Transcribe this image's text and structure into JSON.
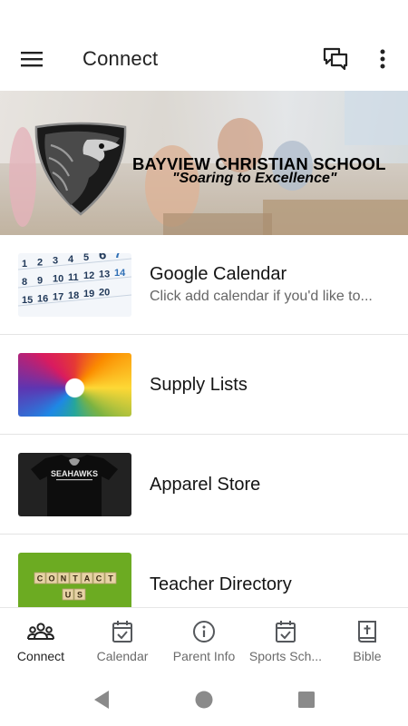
{
  "app_bar": {
    "title": "Connect",
    "menu_icon": "hamburger-menu-icon",
    "chat_icon": "chat-bubbles-icon",
    "more_icon": "more-vertical-icon"
  },
  "hero": {
    "school_name": "BAYVIEW CHRISTIAN SCHOOL",
    "motto": "\"Soaring to Excellence\"",
    "logo_icon": "hawk-shield-logo"
  },
  "list": {
    "items": [
      {
        "title": "Google Calendar",
        "subtitle": "Click add calendar if you'd like to...",
        "thumb": "calendar-thumbnail"
      },
      {
        "title": "Supply Lists",
        "subtitle": "",
        "thumb": "colored-pencils-thumbnail"
      },
      {
        "title": "Apparel Store",
        "subtitle": "",
        "thumb": "seahawks-shirt-thumbnail"
      },
      {
        "title": "Teacher Directory",
        "subtitle": "",
        "thumb": "contact-us-tiles-thumbnail"
      }
    ],
    "calendar_thumb_numbers": [
      "1",
      "2",
      "3",
      "4",
      "5",
      "6",
      "7",
      "8",
      "9",
      "10",
      "11",
      "12",
      "13",
      "14",
      "15",
      "16",
      "17",
      "18",
      "19",
      "20"
    ],
    "shirt_text": "SEAHAWKS",
    "contact_tiles_row1": [
      "C",
      "O",
      "N",
      "T",
      "A",
      "C",
      "T"
    ],
    "contact_tiles_row2": [
      "U",
      "S"
    ]
  },
  "bottom_nav": {
    "items": [
      {
        "label": "Connect",
        "icon": "group-people-icon",
        "active": true
      },
      {
        "label": "Calendar",
        "icon": "calendar-check-icon",
        "active": false
      },
      {
        "label": "Parent Info",
        "icon": "info-circle-icon",
        "active": false
      },
      {
        "label": "Sports Sch...",
        "icon": "calendar-check-icon",
        "active": false
      },
      {
        "label": "Bible",
        "icon": "bible-book-icon",
        "active": false
      }
    ]
  },
  "system_nav": {
    "back_icon": "back-triangle-icon",
    "home_icon": "home-circle-icon",
    "recents_icon": "recents-square-icon"
  },
  "colors": {
    "primary_text": "#222222",
    "secondary_text": "#666666",
    "nav_icon": "#55585c",
    "divider": "#e4e4e4"
  }
}
